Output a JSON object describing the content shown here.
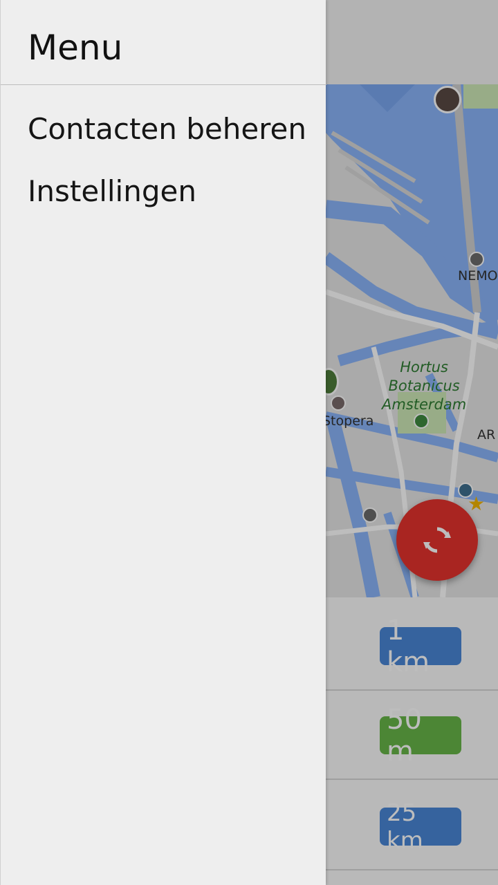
{
  "drawer": {
    "title": "Menu",
    "items": [
      {
        "label": "Contacten beheren"
      },
      {
        "label": "Instellingen"
      }
    ]
  },
  "map": {
    "labels": {
      "hortus": "Hortus\nBotanicus\nAmsterdam",
      "hortus_line1": "Hortus",
      "hortus_line2": "Botanicus",
      "hortus_line3": "Amsterdam",
      "stopera": "Stopera",
      "nemo": "NEMO",
      "artis": "AR"
    },
    "colors": {
      "water": "#8ab4f8",
      "land": "#e8e8e8",
      "park": "#cde8b6",
      "road": "#ffffff"
    }
  },
  "fab": {
    "icon": "refresh-icon",
    "color": "#e5322d"
  },
  "contacts": [
    {
      "distance": "1 km",
      "badge_color": "#4a86d6"
    },
    {
      "distance": "50 m",
      "badge_color": "#67b548"
    },
    {
      "distance": "25 km",
      "badge_color": "#4a86d6"
    }
  ]
}
